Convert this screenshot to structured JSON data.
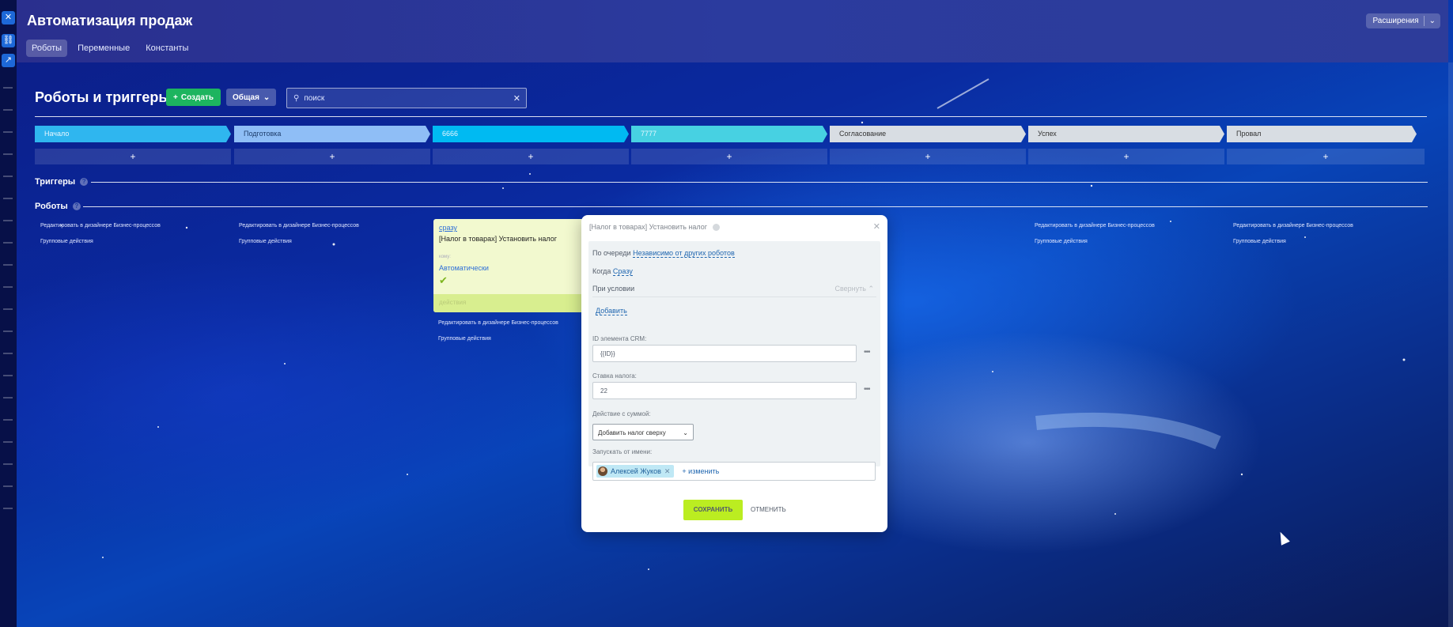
{
  "header": {
    "title": "Автоматизация продаж",
    "tabs": [
      "Роботы",
      "Переменные",
      "Константы"
    ],
    "extensions_label": "Расширения"
  },
  "toolbar": {
    "title": "Роботы и триггеры",
    "create_label": "Создать",
    "common_label": "Общая",
    "search_placeholder": "поиск"
  },
  "stages": [
    {
      "name": "Начало",
      "color": "#2fb6ef"
    },
    {
      "name": "Подготовка",
      "color": "#8fbef6"
    },
    {
      "name": "6666",
      "color": "#00baf2"
    },
    {
      "name": "7777",
      "color": "#47d1e2"
    },
    {
      "name": "Согласование",
      "color": "#d8dde3"
    },
    {
      "name": "Успех",
      "color": "#d8dde3"
    },
    {
      "name": "Провал",
      "color": "#d8dde3"
    }
  ],
  "add_symbol": "+",
  "sections": {
    "triggers": "Триггеры",
    "robots": "Роботы",
    "help": "?"
  },
  "column_links": {
    "edit_designer": "Редактировать в дизайнере Бизнес-процессов",
    "group_actions": "Групповые действия"
  },
  "robot_card": {
    "when": "сразу",
    "title": "[Налог в товарах] Установить налог",
    "for_label": "кому:",
    "who": "Автоматически",
    "actions_label": "действия"
  },
  "modal": {
    "title": "[Налог в товарах] Установить налог",
    "queue_label": "По очереди",
    "queue_value": "Независимо от других роботов",
    "when_label": "Когда",
    "when_value": "Сразу",
    "condition_label": "При условии",
    "collapse_label": "Свернуть",
    "add_label": "Добавить",
    "crm_id_label": "ID элемента CRM:",
    "crm_id_value": "{{ID}}",
    "tax_rate_label": "Ставка налога:",
    "tax_rate_value": "22",
    "action_label": "Действие с суммой:",
    "action_value": "Добавить налог сверху",
    "run_as_label": "Запускать от имени:",
    "run_as_user": "Алексей Жуков",
    "change_label": "+ изменить",
    "save_label": "СОХРАНИТЬ",
    "cancel_label": "ОТМЕНИТЬ"
  }
}
